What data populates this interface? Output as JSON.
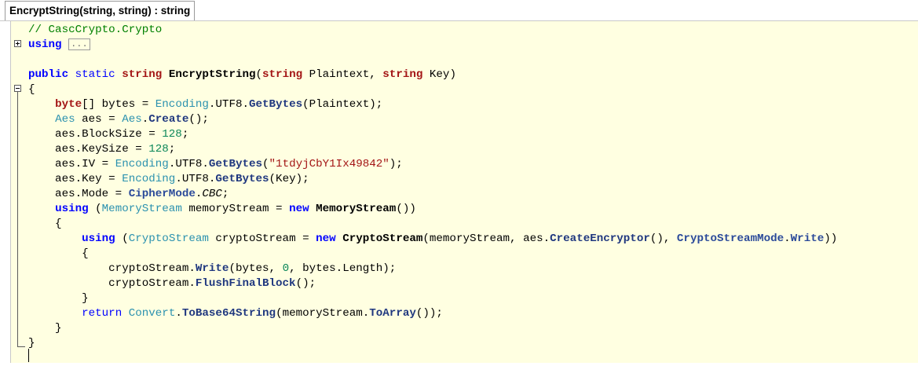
{
  "tab": {
    "title": "EncryptString(string, string) : string"
  },
  "code": {
    "lines": [
      [
        {
          "t": "// CascCrypto.Crypto",
          "c": "cm"
        }
      ],
      [
        {
          "t": "using",
          "c": "kwb"
        },
        {
          "t": " "
        },
        {
          "t": "...",
          "c": "collapsed"
        }
      ],
      [],
      [
        {
          "t": "public",
          "c": "kwb"
        },
        {
          "t": " "
        },
        {
          "t": "static",
          "c": "kw"
        },
        {
          "t": " "
        },
        {
          "t": "string",
          "c": "kwr"
        },
        {
          "t": " "
        },
        {
          "t": "EncryptString",
          "c": "b"
        },
        {
          "t": "("
        },
        {
          "t": "string",
          "c": "kwr"
        },
        {
          "t": " Plaintext, "
        },
        {
          "t": "string",
          "c": "kwr"
        },
        {
          "t": " Key)"
        }
      ],
      [
        {
          "t": "{"
        }
      ],
      [
        {
          "t": "    "
        },
        {
          "t": "byte",
          "c": "kwr"
        },
        {
          "t": "[] bytes = "
        },
        {
          "t": "Encoding",
          "c": "ty"
        },
        {
          "t": ".UTF8."
        },
        {
          "t": "GetBytes",
          "c": "tyb"
        },
        {
          "t": "(Plaintext);"
        }
      ],
      [
        {
          "t": "    "
        },
        {
          "t": "Aes",
          "c": "ty"
        },
        {
          "t": " aes = "
        },
        {
          "t": "Aes",
          "c": "ty"
        },
        {
          "t": "."
        },
        {
          "t": "Create",
          "c": "tyb"
        },
        {
          "t": "();"
        }
      ],
      [
        {
          "t": "    aes.BlockSize = "
        },
        {
          "t": "128",
          "c": "nm"
        },
        {
          "t": ";"
        }
      ],
      [
        {
          "t": "    aes.KeySize = "
        },
        {
          "t": "128",
          "c": "nm"
        },
        {
          "t": ";"
        }
      ],
      [
        {
          "t": "    aes.IV = "
        },
        {
          "t": "Encoding",
          "c": "ty"
        },
        {
          "t": ".UTF8."
        },
        {
          "t": "GetBytes",
          "c": "tyb"
        },
        {
          "t": "("
        },
        {
          "t": "\"1tdyjCbY1Ix49842\"",
          "c": "st"
        },
        {
          "t": ");"
        }
      ],
      [
        {
          "t": "    aes.Key = "
        },
        {
          "t": "Encoding",
          "c": "ty"
        },
        {
          "t": ".UTF8."
        },
        {
          "t": "GetBytes",
          "c": "tyb"
        },
        {
          "t": "(Key);"
        }
      ],
      [
        {
          "t": "    aes.Mode = "
        },
        {
          "t": "CipherMode",
          "c": "en"
        },
        {
          "t": "."
        },
        {
          "t": "CBC",
          "c": "it"
        },
        {
          "t": ";"
        }
      ],
      [
        {
          "t": "    "
        },
        {
          "t": "using",
          "c": "kwb"
        },
        {
          "t": " ("
        },
        {
          "t": "MemoryStream",
          "c": "ty"
        },
        {
          "t": " memoryStream = "
        },
        {
          "t": "new",
          "c": "kwb"
        },
        {
          "t": " "
        },
        {
          "t": "MemoryStream",
          "c": "b"
        },
        {
          "t": "())"
        }
      ],
      [
        {
          "t": "    {"
        }
      ],
      [
        {
          "t": "        "
        },
        {
          "t": "using",
          "c": "kwb"
        },
        {
          "t": " ("
        },
        {
          "t": "CryptoStream",
          "c": "ty"
        },
        {
          "t": " cryptoStream = "
        },
        {
          "t": "new",
          "c": "kwb"
        },
        {
          "t": " "
        },
        {
          "t": "CryptoStream",
          "c": "b"
        },
        {
          "t": "(memoryStream, aes."
        },
        {
          "t": "CreateEncryptor",
          "c": "tyb"
        },
        {
          "t": "(), "
        },
        {
          "t": "CryptoStreamMode",
          "c": "en"
        },
        {
          "t": "."
        },
        {
          "t": "Write",
          "c": "en"
        },
        {
          "t": "))"
        }
      ],
      [
        {
          "t": "        {"
        }
      ],
      [
        {
          "t": "            cryptoStream."
        },
        {
          "t": "Write",
          "c": "tyb"
        },
        {
          "t": "(bytes, "
        },
        {
          "t": "0",
          "c": "nm"
        },
        {
          "t": ", bytes.Length);"
        }
      ],
      [
        {
          "t": "            cryptoStream."
        },
        {
          "t": "FlushFinalBlock",
          "c": "tyb"
        },
        {
          "t": "();"
        }
      ],
      [
        {
          "t": "        }"
        }
      ],
      [
        {
          "t": "        "
        },
        {
          "t": "return",
          "c": "kw"
        },
        {
          "t": " "
        },
        {
          "t": "Convert",
          "c": "ty"
        },
        {
          "t": "."
        },
        {
          "t": "ToBase64String",
          "c": "tyb"
        },
        {
          "t": "(memoryStream."
        },
        {
          "t": "ToArray",
          "c": "tyb"
        },
        {
          "t": "());"
        }
      ],
      [
        {
          "t": "    }"
        }
      ],
      [
        {
          "t": "}"
        }
      ],
      []
    ]
  }
}
